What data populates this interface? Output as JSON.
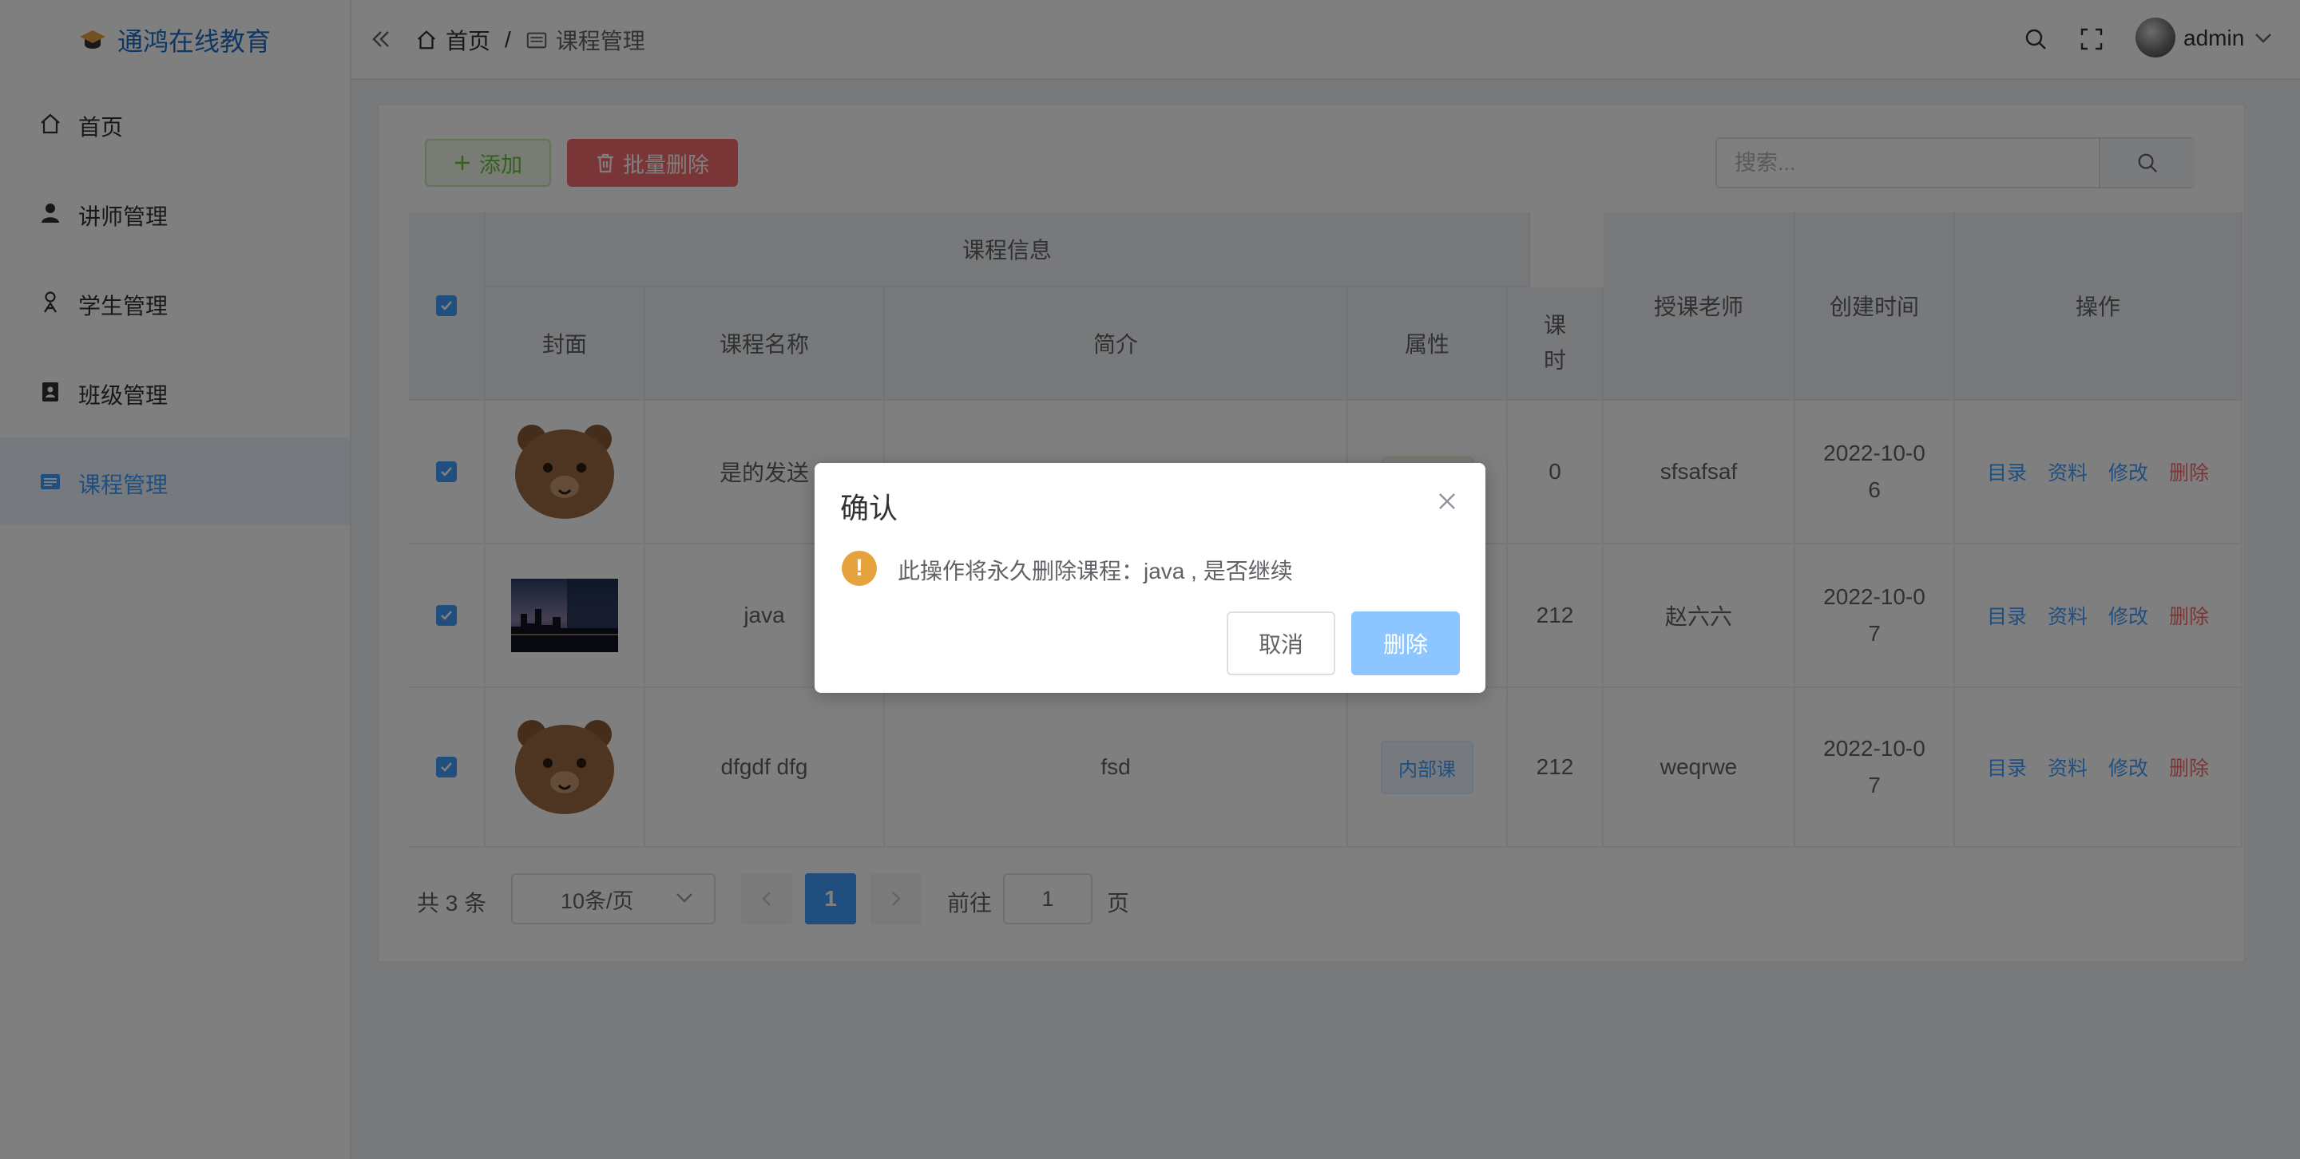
{
  "app": {
    "name": "通鸿在线教育",
    "brand_color": "#1e6fc8"
  },
  "sidebar": {
    "items": [
      {
        "label": "首页",
        "icon": "home-icon"
      },
      {
        "label": "讲师管理",
        "icon": "user-icon"
      },
      {
        "label": "学生管理",
        "icon": "student-icon"
      },
      {
        "label": "班级管理",
        "icon": "class-icon"
      },
      {
        "label": "课程管理",
        "icon": "course-icon",
        "active": true
      }
    ]
  },
  "header": {
    "breadcrumb": [
      {
        "label": "首页",
        "icon": "home-icon"
      },
      {
        "label": "课程管理",
        "icon": "course-icon"
      }
    ],
    "separator": "/",
    "username": "admin"
  },
  "toolbar": {
    "add_label": "添加",
    "batch_delete_label": "批量删除",
    "search_placeholder": "搜索..."
  },
  "table": {
    "group_header": "课程信息",
    "columns": {
      "cover": "封面",
      "name": "课程名称",
      "intro": "简介",
      "attr": "属性",
      "hours_1": "课",
      "hours_2": "时",
      "teacher": "授课老师",
      "created": "创建时间",
      "actions": "操作"
    },
    "action_labels": {
      "catalog": "目录",
      "materials": "资料",
      "edit": "修改",
      "delete": "删除"
    },
    "rows": [
      {
        "checked": true,
        "cover": "bear",
        "name": "是的发送",
        "intro": "",
        "attr": "",
        "hours": "0",
        "teacher": "sfsafsaf",
        "created_1": "2022-10-0",
        "created_2": "6"
      },
      {
        "checked": true,
        "cover": "city-night",
        "name": "java",
        "intro": "",
        "attr": "",
        "hours": "212",
        "teacher": "赵六六",
        "created_1": "2022-10-0",
        "created_2": "7"
      },
      {
        "checked": true,
        "cover": "bear",
        "name": "dfgdf dfg",
        "intro": "fsd",
        "attr": "内部课",
        "hours": "212",
        "teacher": "weqrwe",
        "created_1": "2022-10-0",
        "created_2": "7"
      }
    ]
  },
  "pagination": {
    "total": "共 3 条",
    "page_size": "10条/页",
    "current_page": "1",
    "goto_label": "前往",
    "goto_value": "1",
    "page_suffix": "页"
  },
  "dialog": {
    "title": "确认",
    "message": "此操作将永久删除课程：java , 是否继续",
    "cancel_label": "取消",
    "confirm_label": "删除",
    "warning_color": "#e6a23c"
  }
}
